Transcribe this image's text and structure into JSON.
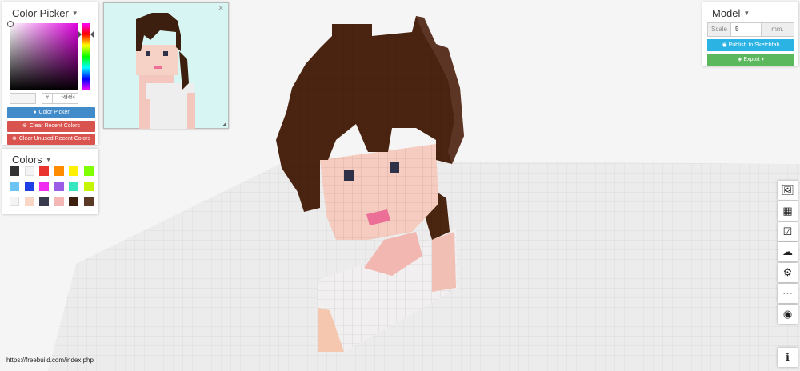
{
  "color_picker": {
    "title": "Color Picker",
    "hex_prefix": "#",
    "hex_value": "f4f4f4",
    "current_color": "#f4f4f4",
    "buttons": {
      "color_picker": "Color Picker",
      "clear_recent": "Clear Recent Colors",
      "clear_unused": "Clear Unused Recent Colors"
    }
  },
  "colors_panel": {
    "title": "Colors",
    "swatches": [
      "#333333",
      "#f4f4f4",
      "#e8332f",
      "#ff8c00",
      "#ffef00",
      "#7fff00",
      "#6cc4f5",
      "#1f3fe6",
      "#ef2cf0",
      "#9b5de5",
      "#35e6c1",
      "#c6f500",
      "#f4f4f4",
      "#f9d6c6",
      "#3a3a4d",
      "#f3b8b5",
      "#3c1f0e",
      "#5a3a26"
    ]
  },
  "model_panel": {
    "title": "Model",
    "scale_label": "Scale",
    "scale_value": "5",
    "scale_unit": "mm.",
    "publish_label": "Publish to Sketchfab",
    "export_label": "Export"
  },
  "toolbar": [
    "image-icon",
    "grid-icon",
    "checklist-icon",
    "upload-cloud-icon",
    "gear-icon",
    "more-icon",
    "eye-icon",
    "info-icon"
  ],
  "status_url": "https://freebuild.com/index.php"
}
